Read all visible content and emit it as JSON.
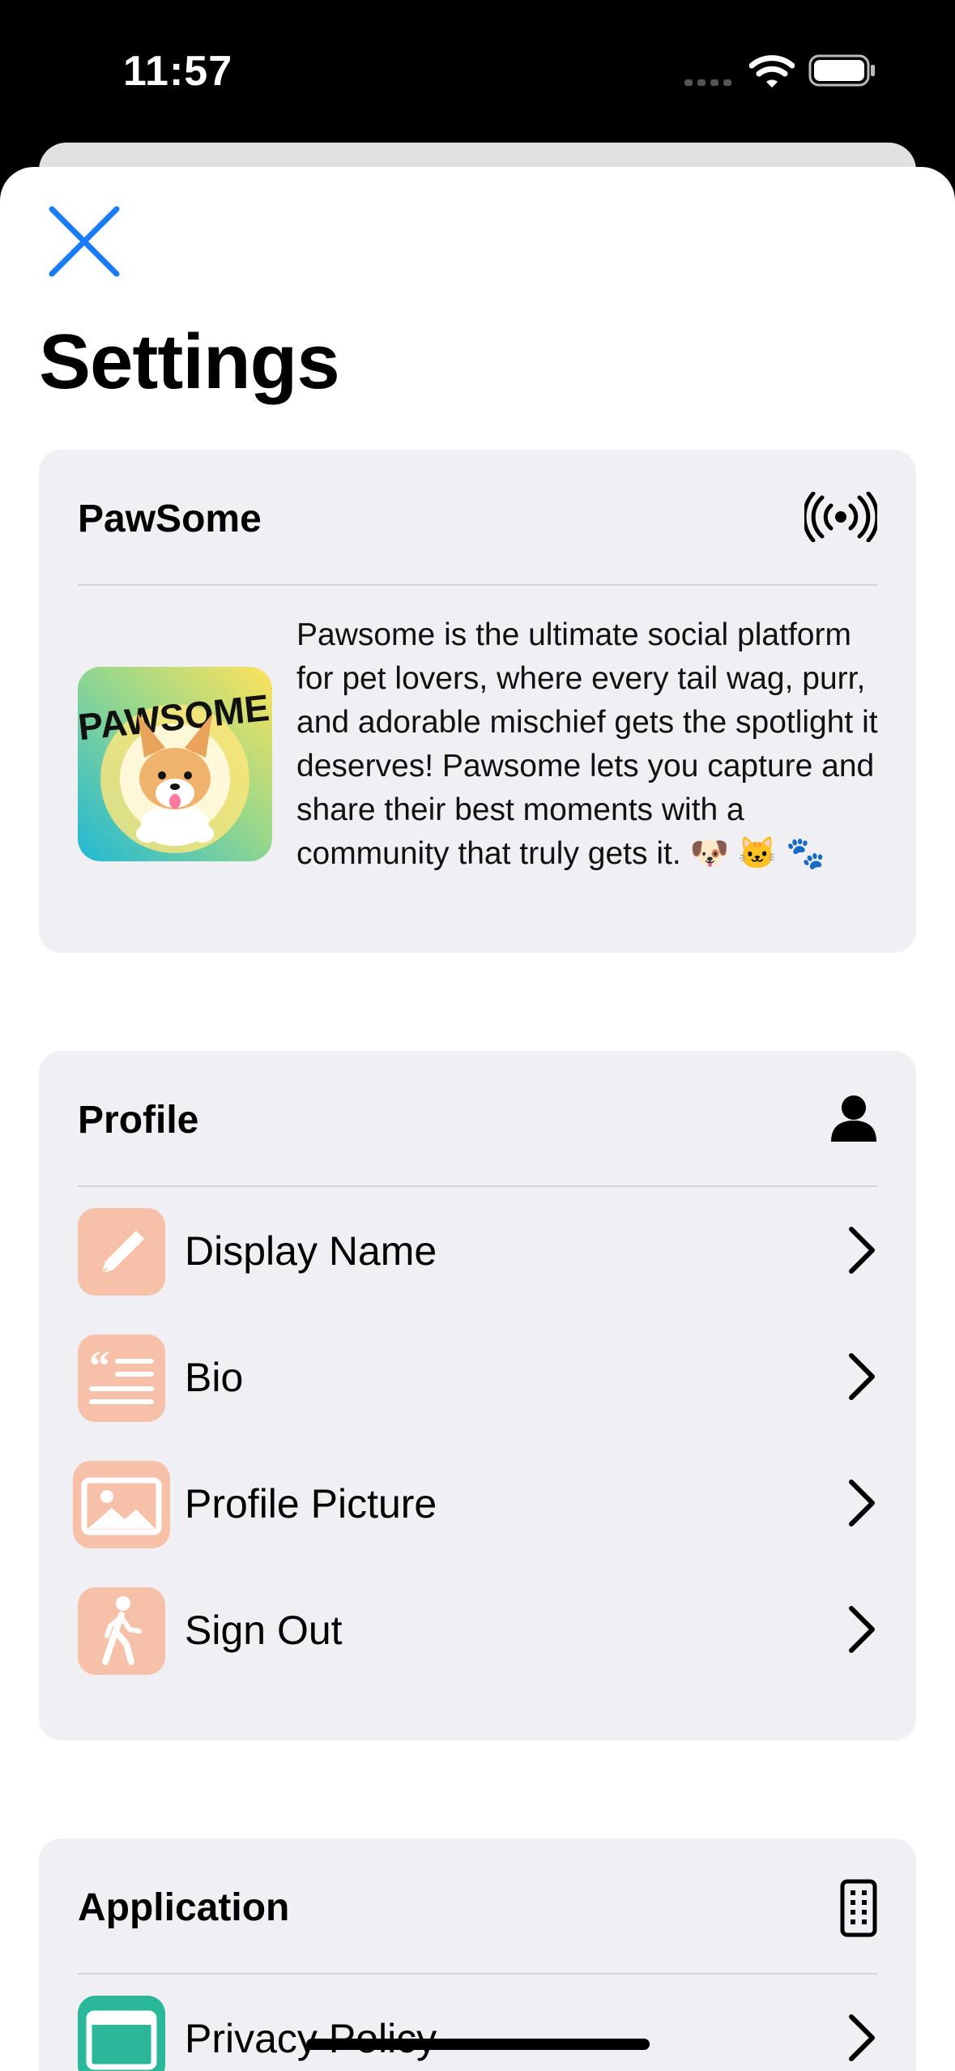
{
  "status_bar": {
    "time": "11:57"
  },
  "header": {
    "title": "Settings"
  },
  "about_card": {
    "title": "PawSome",
    "description": "Pawsome is the ultimate social platform for pet lovers, where every tail wag, purr, and adorable mischief gets the spotlight it deserves! Pawsome lets you capture and share their best moments with a community that truly gets it. 🐶 🐱 🐾",
    "logo_text": "PAWSOME",
    "header_icon": "broadcast-icon"
  },
  "profile_card": {
    "title": "Profile",
    "header_icon": "person-icon",
    "items": [
      {
        "label": "Display Name",
        "icon": "pencil-icon"
      },
      {
        "label": "Bio",
        "icon": "quote-text-icon"
      },
      {
        "label": "Profile Picture",
        "icon": "photo-icon"
      },
      {
        "label": "Sign Out",
        "icon": "walking-figure-icon"
      }
    ]
  },
  "application_card": {
    "title": "Application",
    "header_icon": "phone-icon",
    "items": [
      {
        "label": "Privacy Policy",
        "icon": "document-icon"
      }
    ]
  },
  "colors": {
    "accent": "#1a7cf5",
    "row_icon_bg": "#f6c1a8",
    "privacy_icon_bg": "#2bb89a",
    "card_bg": "#efeff4"
  }
}
